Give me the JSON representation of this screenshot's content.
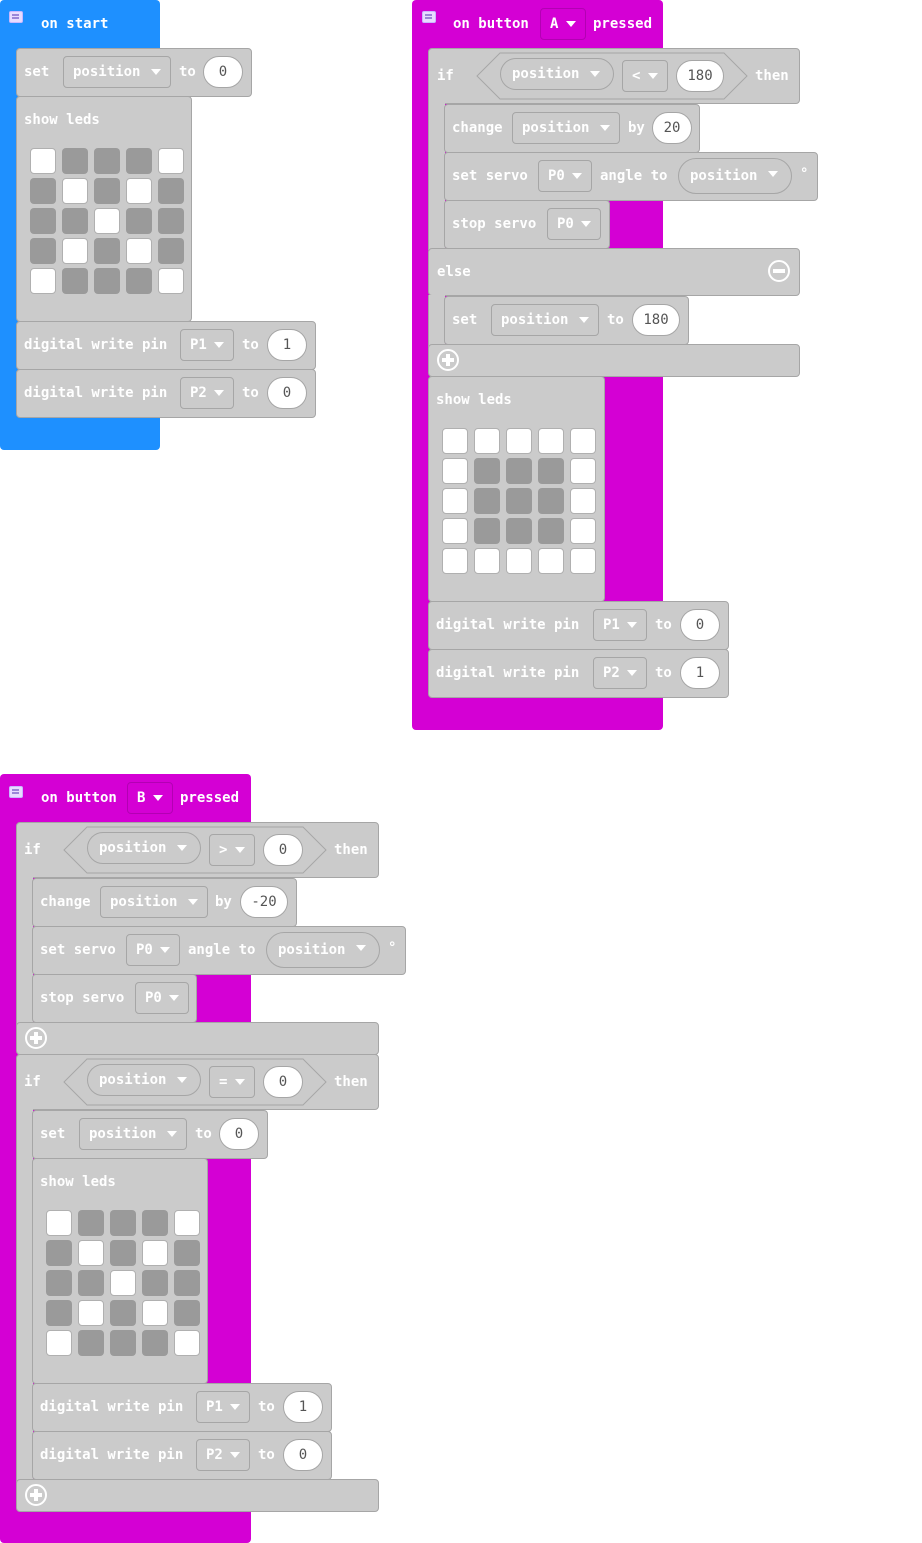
{
  "on_start": {
    "label": "on start",
    "set_label": "set",
    "set_var": "position",
    "to_label": "to",
    "set_value": "0",
    "show_leds_label": "show leds",
    "leds": [
      [
        1,
        0,
        0,
        0,
        1
      ],
      [
        0,
        1,
        0,
        1,
        0
      ],
      [
        0,
        0,
        1,
        0,
        0
      ],
      [
        0,
        1,
        0,
        1,
        0
      ],
      [
        1,
        0,
        0,
        0,
        1
      ]
    ],
    "dw1": {
      "label": "digital write pin",
      "pin": "P1",
      "to": "to",
      "value": "1"
    },
    "dw2": {
      "label": "digital write pin",
      "pin": "P2",
      "to": "to",
      "value": "0"
    }
  },
  "on_a": {
    "on_label": "on button",
    "button": "A",
    "pressed_label": "pressed",
    "if_label": "if",
    "cond_var": "position",
    "cond_op": "<",
    "cond_value": "180",
    "then_label": "then",
    "change_label": "change",
    "change_var": "position",
    "by_label": "by",
    "change_value": "20",
    "servo_label": "set servo",
    "servo_pin": "P0",
    "angle_label": "angle to",
    "angle_var": "position",
    "degree": "°",
    "stop_label": "stop servo",
    "stop_pin": "P0",
    "else_label": "else",
    "else_set_label": "set",
    "else_set_var": "position",
    "else_to_label": "to",
    "else_set_value": "180",
    "show_leds_label": "show leds",
    "leds": [
      [
        1,
        1,
        1,
        1,
        1
      ],
      [
        1,
        0,
        0,
        0,
        1
      ],
      [
        1,
        0,
        0,
        0,
        1
      ],
      [
        1,
        0,
        0,
        0,
        1
      ],
      [
        1,
        1,
        1,
        1,
        1
      ]
    ],
    "dw1": {
      "label": "digital write pin",
      "pin": "P1",
      "to": "to",
      "value": "0"
    },
    "dw2": {
      "label": "digital write pin",
      "pin": "P2",
      "to": "to",
      "value": "1"
    }
  },
  "on_b": {
    "on_label": "on button",
    "button": "B",
    "pressed_label": "pressed",
    "if1_label": "if",
    "if1_var": "position",
    "if1_op": ">",
    "if1_value": "0",
    "then1_label": "then",
    "change_label": "change",
    "change_var": "position",
    "by_label": "by",
    "change_value": "-20",
    "servo_label": "set servo",
    "servo_pin": "P0",
    "angle_label": "angle to",
    "angle_var": "position",
    "degree": "°",
    "stop_label": "stop servo",
    "stop_pin": "P0",
    "if2_label": "if",
    "if2_var": "position",
    "if2_op": "=",
    "if2_value": "0",
    "then2_label": "then",
    "set_label": "set",
    "set_var": "position",
    "to_label": "to",
    "set_value": "0",
    "show_leds_label": "show leds",
    "leds": [
      [
        1,
        0,
        0,
        0,
        1
      ],
      [
        0,
        1,
        0,
        1,
        0
      ],
      [
        0,
        0,
        1,
        0,
        0
      ],
      [
        0,
        1,
        0,
        1,
        0
      ],
      [
        1,
        0,
        0,
        0,
        1
      ]
    ],
    "dw1": {
      "label": "digital write pin",
      "pin": "P1",
      "to": "to",
      "value": "1"
    },
    "dw2": {
      "label": "digital write pin",
      "pin": "P2",
      "to": "to",
      "value": "0"
    }
  }
}
